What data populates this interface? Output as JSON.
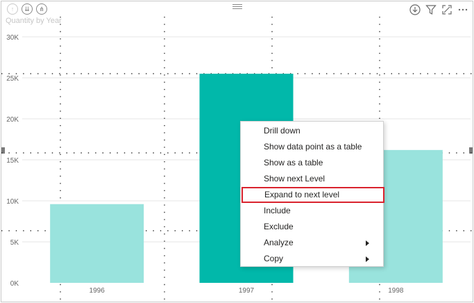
{
  "visual": {
    "title": "Quantity by Year",
    "header_icons": [
      "drill-up-icon",
      "drill-all-down-icon",
      "expand-all-down-icon"
    ],
    "toolbar_icons": [
      "drill-mode-icon",
      "filter-icon",
      "focus-mode-icon",
      "more-options-icon"
    ]
  },
  "chart_data": {
    "type": "bar",
    "categories": [
      "1996",
      "1997",
      "1998"
    ],
    "values": [
      9600,
      25500,
      16200
    ],
    "title": "Quantity by Year",
    "xlabel": "",
    "ylabel": "",
    "ylim": [
      0,
      30000
    ],
    "yticks": [
      "0K",
      "5K",
      "10K",
      "15K",
      "20K",
      "25K",
      "30K"
    ],
    "grid": true,
    "colors": {
      "highlighted": "#01b8aa",
      "dimmed": "#99e3dd"
    },
    "highlighted_category": "1997"
  },
  "context_menu": {
    "items": [
      {
        "label": "Drill down",
        "submenu": false
      },
      {
        "label": "Show data point as a table",
        "submenu": false
      },
      {
        "label": "Show as a table",
        "submenu": false
      },
      {
        "label": "Show next Level",
        "submenu": false
      },
      {
        "label": "Expand to next level",
        "submenu": false,
        "highlighted": true
      },
      {
        "label": "Include",
        "submenu": false
      },
      {
        "label": "Exclude",
        "submenu": false
      },
      {
        "label": "Analyze",
        "submenu": true
      },
      {
        "label": "Copy",
        "submenu": true
      }
    ],
    "highlight_color": "#d9232e"
  }
}
